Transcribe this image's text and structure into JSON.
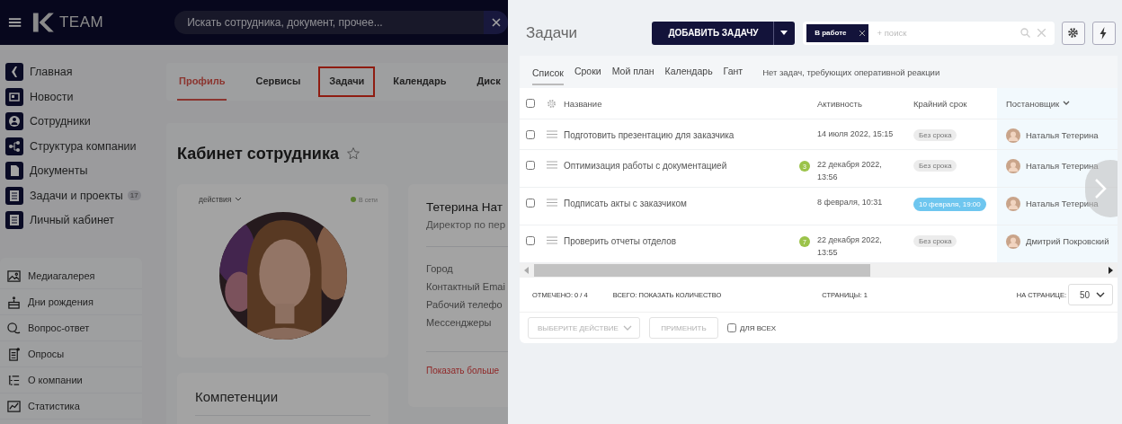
{
  "header": {
    "logo": "TEAM",
    "search_placeholder": "Искать сотрудника, документ, прочее..."
  },
  "sidebar": {
    "main_items": [
      {
        "label": "Главная"
      },
      {
        "label": "Новости"
      },
      {
        "label": "Сотрудники"
      },
      {
        "label": "Структура компании"
      },
      {
        "label": "Документы"
      },
      {
        "label": "Задачи и проекты",
        "badge": "17"
      },
      {
        "label": "Личный кабинет"
      }
    ],
    "extra_items": [
      {
        "label": "Медиагалерея"
      },
      {
        "label": "Дни рождения"
      },
      {
        "label": "Вопрос-ответ"
      },
      {
        "label": "Опросы"
      },
      {
        "label": "О компании"
      },
      {
        "label": "Статистика"
      }
    ]
  },
  "profile_tabs": [
    {
      "label": "Профиль",
      "selected": true,
      "highlighted": false
    },
    {
      "label": "Сервисы",
      "selected": false,
      "highlighted": false
    },
    {
      "label": "Задачи",
      "selected": false,
      "highlighted": true
    },
    {
      "label": "Календарь",
      "selected": false,
      "highlighted": false
    },
    {
      "label": "Диск",
      "selected": false,
      "highlighted": false
    }
  ],
  "page": {
    "title": "Кабинет сотрудника",
    "favorite": false,
    "profile_card": {
      "actions": "действия",
      "status": "В сети",
      "online": true
    },
    "info_card": {
      "name": "Тетерина Нат",
      "position": "Директор по пер",
      "fields": [
        "Город",
        "Контактный Emai",
        "Рабочий телефо",
        "Мессенджеры"
      ],
      "more_link": "Показать больше"
    },
    "competencies": {
      "title": "Компетенции"
    }
  },
  "tasks": {
    "title": "Задачи",
    "add_button": "ДОБАВИТЬ ЗАДАЧУ",
    "filter_chip": "В работе",
    "search_placeholder": "+ поиск",
    "views": [
      {
        "label": "Список",
        "selected": true
      },
      {
        "label": "Сроки",
        "selected": false
      },
      {
        "label": "Мой план",
        "selected": false
      },
      {
        "label": "Календарь",
        "selected": false
      },
      {
        "label": "Гант",
        "selected": false
      }
    ],
    "notice": "Нет задач, требующих оперативной реакции",
    "all_checked": false,
    "columns": [
      {
        "label": "Название",
        "sorted": false
      },
      {
        "label": "Активность",
        "sorted": false
      },
      {
        "label": "Крайний срок",
        "sorted": false
      },
      {
        "label": "Постановщик",
        "sorted": true
      }
    ],
    "rows": [
      {
        "checked": false,
        "title": "Подготовить презентацию для заказчика",
        "activity": "14 июля 2022, 15:15",
        "deadline": {
          "text": "Без срока",
          "kind": "none"
        },
        "assignee": "Наталья Тетерина"
      },
      {
        "checked": false,
        "title": "Оптимизация работы с документацией",
        "counter": "3",
        "activity": "22 декабря 2022, 13:56",
        "deadline": {
          "text": "Без срока",
          "kind": "none"
        },
        "assignee": "Наталья Тетерина"
      },
      {
        "checked": false,
        "title": "Подписать акты с заказчиком",
        "activity": "8 февраля, 10:31",
        "deadline": {
          "text": "10 февраля, 19:00",
          "kind": "date"
        },
        "assignee": "Наталья Тетерина"
      },
      {
        "checked": false,
        "title": "Проверить отчеты отделов",
        "counter": "7",
        "activity": "22 декабря 2022, 13:55",
        "deadline": {
          "text": "Без срока",
          "kind": "none"
        },
        "assignee": "Дмитрий Покровский"
      }
    ],
    "footer": {
      "marked": "ОТМЕЧЕНО: 0 / 4",
      "total": "ВСЕГО: ПОКАЗАТЬ КОЛИЧЕСТВО",
      "pages": "СТРАНИЦЫ: 1",
      "per_page_label": "НА СТРАНИЦЕ:",
      "per_page": "50"
    },
    "actions": {
      "select_placeholder": "ВЫБЕРИТЕ ДЕЙСТВИЕ",
      "apply": "ПРИМЕНИТЬ",
      "disabled": true,
      "for_all": {
        "label": "ДЛЯ ВСЕХ",
        "checked": false
      }
    }
  }
}
